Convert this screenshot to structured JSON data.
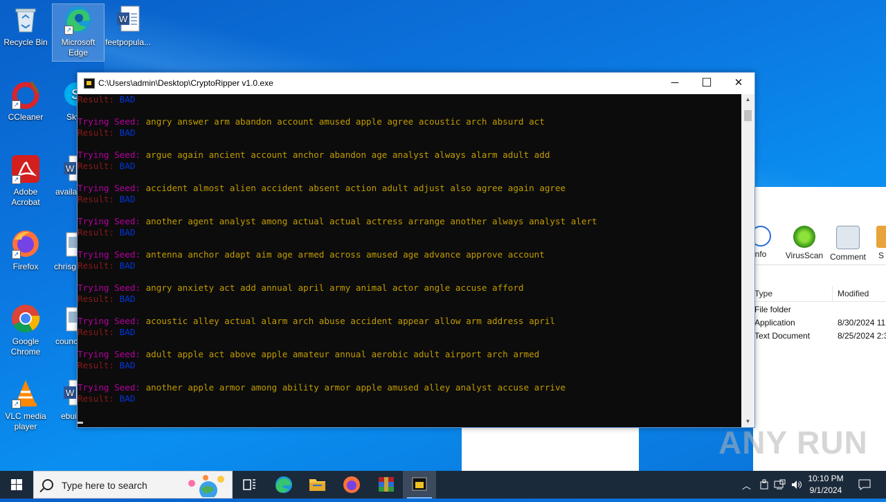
{
  "desktop": {
    "icons": [
      {
        "label": "Recycle Bin",
        "icon": "recycle-bin-icon"
      },
      {
        "label": "Microsoft Edge",
        "icon": "edge-icon"
      },
      {
        "label": "feetpopula...",
        "icon": "word-document-icon"
      },
      {
        "label": "CCleaner",
        "icon": "ccleaner-icon"
      },
      {
        "label": "Sky",
        "icon": "skype-icon"
      },
      {
        "label": "Adobe Acrobat",
        "icon": "acrobat-icon"
      },
      {
        "label": "availa",
        "icon": "word-document-icon"
      },
      {
        "label": "Firefox",
        "icon": "firefox-icon"
      },
      {
        "label": "chrisg",
        "icon": "image-file-icon"
      },
      {
        "label": "Google Chrome",
        "icon": "chrome-icon"
      },
      {
        "label": "counc",
        "icon": "image-file-icon"
      },
      {
        "label": "VLC media player",
        "icon": "vlc-icon"
      },
      {
        "label": "ebui",
        "icon": "word-document-icon"
      }
    ]
  },
  "console": {
    "title": "C:\\Users\\admin\\Desktop\\CryptoRipper v1.0.exe",
    "minimize": "─",
    "maximize": "☐",
    "close": "✕",
    "top_result": {
      "label": "Result: ",
      "value": "BAD"
    },
    "entries": [
      {
        "label": "Trying Seed: ",
        "seed": "angry answer arm abandon account amused apple agree acoustic arch absurd act",
        "result_label": "Result: ",
        "result": "BAD"
      },
      {
        "label": "Trying Seed: ",
        "seed": "argue again ancient account anchor abandon age analyst always alarm adult add",
        "result_label": "Result: ",
        "result": "BAD"
      },
      {
        "label": "Trying Seed: ",
        "seed": "accident almost alien accident absent action adult adjust also agree again agree",
        "result_label": "Result: ",
        "result": "BAD"
      },
      {
        "label": "Trying Seed: ",
        "seed": "another agent analyst among actual actual actress arrange another always analyst alert",
        "result_label": "Result: ",
        "result": "BAD"
      },
      {
        "label": "Trying Seed: ",
        "seed": "antenna anchor adapt aim age armed across amused age advance approve account",
        "result_label": "Result: ",
        "result": "BAD"
      },
      {
        "label": "Trying Seed: ",
        "seed": "angry anxiety act add annual april army animal actor angle accuse afford",
        "result_label": "Result: ",
        "result": "BAD"
      },
      {
        "label": "Trying Seed: ",
        "seed": "acoustic alley actual alarm arch abuse accident appear allow arm address april",
        "result_label": "Result: ",
        "result": "BAD"
      },
      {
        "label": "Trying Seed: ",
        "seed": "adult apple act above apple amateur annual aerobic adult airport arch armed",
        "result_label": "Result: ",
        "result": "BAD"
      },
      {
        "label": "Trying Seed: ",
        "seed": "another apple armor among ability armor apple amused alley analyst accuse arrive",
        "result_label": "Result: ",
        "result": "BAD"
      }
    ]
  },
  "explorer": {
    "ribbon": [
      {
        "label": "nfo",
        "icon": "info-icon"
      },
      {
        "label": "VirusScan",
        "icon": "virusscan-icon"
      },
      {
        "label": "Comment",
        "icon": "comment-icon"
      },
      {
        "label": "S",
        "icon": "share-icon"
      }
    ],
    "columns": [
      "Type",
      "Modified"
    ],
    "rows": [
      {
        "type": "File folder",
        "modified": ""
      },
      {
        "type": "Application",
        "modified": "8/30/2024 11:"
      },
      {
        "type": "Text Document",
        "modified": "8/25/2024 2:3"
      }
    ]
  },
  "watermark": "ANY RUN",
  "taskbar": {
    "search_placeholder": "Type here to search",
    "apps": [
      "task-view-icon",
      "edge-icon",
      "file-explorer-icon",
      "firefox-icon",
      "winrar-icon",
      "cryptoripper-icon"
    ],
    "time": "10:10 PM",
    "date": "9/1/2024"
  }
}
